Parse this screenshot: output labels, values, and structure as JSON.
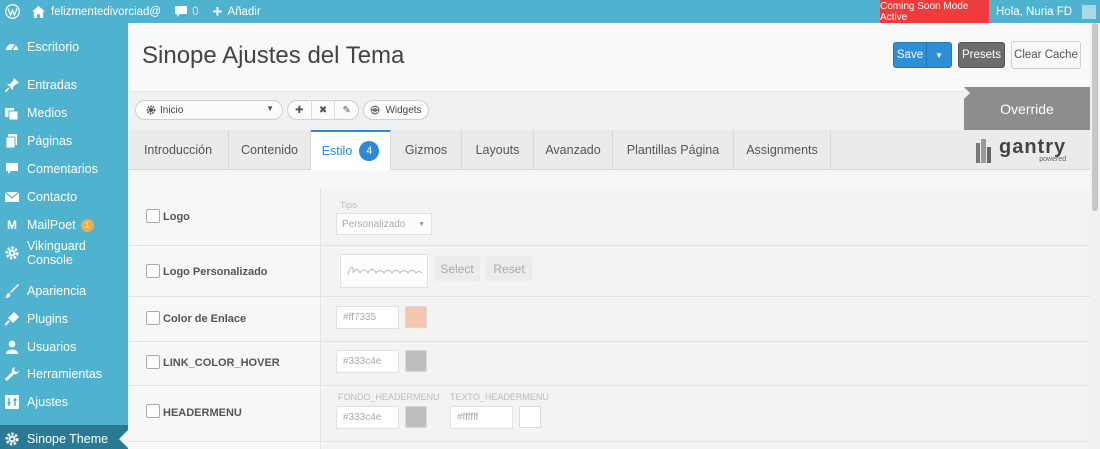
{
  "adminbar": {
    "site_name": "felizmentedivorciad@",
    "comments_count": "0",
    "new_label": "Añadir",
    "coming_soon": "Coming Soon Mode Active",
    "greeting": "Hola, Nuria FD"
  },
  "sidebar": {
    "items": [
      {
        "label": "Escritorio",
        "icon": "dashboard-icon"
      },
      {
        "label": "Entradas",
        "icon": "pin-icon"
      },
      {
        "label": "Medios",
        "icon": "media-icon"
      },
      {
        "label": "Páginas",
        "icon": "pages-icon"
      },
      {
        "label": "Comentarios",
        "icon": "comment-icon"
      },
      {
        "label": "Contacto",
        "icon": "envelope-icon"
      },
      {
        "label": "MailPoet",
        "icon": "mailpoet-icon",
        "badge": "1"
      },
      {
        "label": "Vikinguard Console",
        "icon": "gear-icon"
      },
      {
        "label": "Apariencia",
        "icon": "brush-icon"
      },
      {
        "label": "Plugins",
        "icon": "plug-icon"
      },
      {
        "label": "Usuarios",
        "icon": "user-icon"
      },
      {
        "label": "Herramientas",
        "icon": "wrench-icon"
      },
      {
        "label": "Ajustes",
        "icon": "settings-icon"
      },
      {
        "label": "Sinope Theme",
        "icon": "gear-icon",
        "current": true
      }
    ]
  },
  "header": {
    "title": "Sinope Ajustes del Tema",
    "save_label": "Save",
    "presets_label": "Presets",
    "clear_cache_label": "Clear Cache"
  },
  "toolbar": {
    "selected_preset": "Inicio",
    "widgets_label": "Widgets",
    "override_label": "Override"
  },
  "tabs": {
    "items": [
      {
        "label": "Introducción"
      },
      {
        "label": "Contenido"
      },
      {
        "label": "Estilo",
        "badge": "4",
        "active": true
      },
      {
        "label": "Gizmos"
      },
      {
        "label": "Layouts"
      },
      {
        "label": "Avanzado"
      },
      {
        "label": "Plantillas Página"
      },
      {
        "label": "Assignments"
      }
    ],
    "brand_main": "gantry",
    "brand_sub": "powered"
  },
  "settings": {
    "logo": {
      "label": "Logo",
      "type_caption": "Tipo",
      "type_value": "Personalizado"
    },
    "custom_logo": {
      "label": "Logo Personalizado",
      "preview_text": "felizmentedivorciad@",
      "select_label": "Select",
      "reset_label": "Reset"
    },
    "link_color": {
      "label": "Color de Enlace",
      "value": "#ff7335",
      "swatch": "#f5c5ad"
    },
    "link_color_hover": {
      "label": "LINK_COLOR_HOVER",
      "value": "#333c4e",
      "swatch": "#bdbdbd"
    },
    "headermenu": {
      "label": "HEADERMENU",
      "bg_caption": "FONDO_HEADERMENU",
      "bg_value": "#333c4e",
      "bg_swatch": "#bdbdbd",
      "text_caption": "TEXTO_HEADERMENU",
      "text_value": "#ffffff",
      "text_swatch": "#ffffff"
    }
  },
  "colors": {
    "accent": "#4fb3cf",
    "active_tab": "#2b8ad6",
    "coming_soon_bg": "#ee3b3b"
  }
}
